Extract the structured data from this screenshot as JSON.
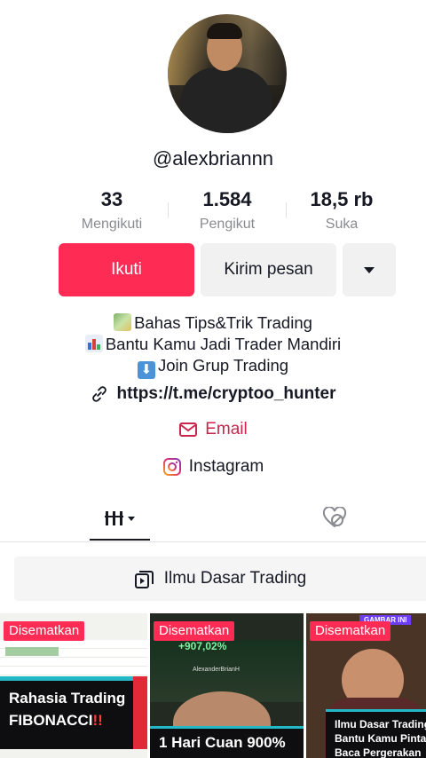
{
  "profile": {
    "handle": "@alexbriannn",
    "stats": [
      {
        "value": "33",
        "label": "Mengikuti"
      },
      {
        "value": "1.584",
        "label": "Pengikut"
      },
      {
        "value": "18,5 rb",
        "label": "Suka"
      }
    ]
  },
  "actions": {
    "follow_label": "Ikuti",
    "message_label": "Kirim pesan"
  },
  "bio": {
    "line1": "Bahas Tips&Trik Trading",
    "line2": "Bantu Kamu Jadi Trader Mandiri",
    "line3": "Join Grup Trading",
    "link": "https://t.me/cryptoo_hunter",
    "email_label": "Email",
    "instagram_label": "Instagram"
  },
  "playlist": {
    "label": "Ilmu Dasar Trading"
  },
  "videos": [
    {
      "badge": "Disematkan",
      "caption_line1": "Rahasia Trading",
      "caption_line2": "FIBONACCI",
      "caption_mark": "!!"
    },
    {
      "badge": "Disematkan",
      "overlay_value": "+907,02%",
      "overlay_name": "AlexanderBrianH",
      "caption": "1 Hari Cuan 900%"
    },
    {
      "badge": "Disematkan",
      "tag": "GAMBAR INI",
      "caption_line1": "Ilmu Dasar Trading",
      "caption_line2": "Bantu Kamu Pinta",
      "caption_line3": "Baca Pergerakan"
    }
  ],
  "colors": {
    "accent": "#fe2c55",
    "email": "#c8264a",
    "text": "#161823",
    "muted": "#8a8b91",
    "button_bg": "#f1f1f2"
  },
  "icons": {
    "link": "link-icon",
    "email": "mail-icon",
    "instagram": "instagram-icon",
    "grid_tab": "grid-icon",
    "liked_tab": "hidden-heart-icon",
    "playlist": "playlist-icon",
    "more": "caret-down-icon"
  }
}
